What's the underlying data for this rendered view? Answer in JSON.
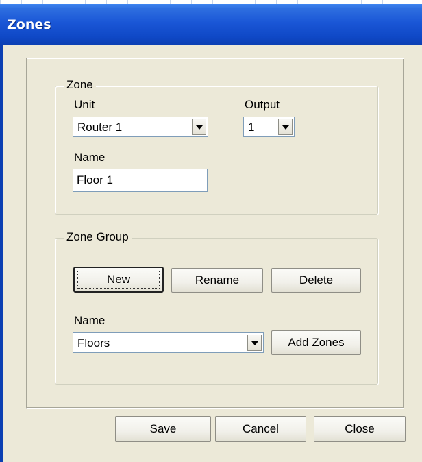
{
  "window": {
    "title": "Zones"
  },
  "zone": {
    "legend": "Zone",
    "unit_label": "Unit",
    "unit_value": "Router 1",
    "output_label": "Output",
    "output_value": "1",
    "name_label": "Name",
    "name_value": "Floor 1"
  },
  "zone_group": {
    "legend": "Zone Group",
    "new_label": "New",
    "rename_label": "Rename",
    "delete_label": "Delete",
    "name_label": "Name",
    "name_value": "Floors",
    "add_zones_label": "Add Zones"
  },
  "footer": {
    "save_label": "Save",
    "cancel_label": "Cancel",
    "close_label": "Close"
  },
  "colors": {
    "titlebar": "#0f48c6",
    "dialog_background": "#ece9d8",
    "input_border": "#7f9db9"
  }
}
